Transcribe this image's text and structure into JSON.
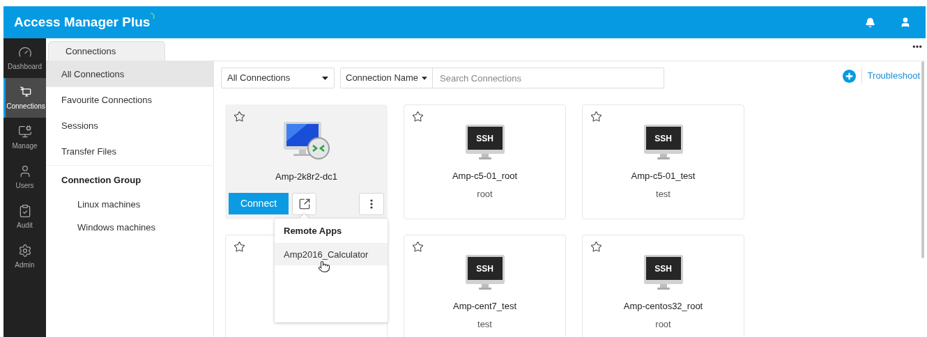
{
  "header": {
    "title": "Access Manager Plus"
  },
  "nav": [
    {
      "label": "Dashboard",
      "selected": false
    },
    {
      "label": "Connections",
      "selected": true
    },
    {
      "label": "Manage",
      "selected": false
    },
    {
      "label": "Users",
      "selected": false
    },
    {
      "label": "Audit",
      "selected": false
    },
    {
      "label": "Admin",
      "selected": false
    }
  ],
  "tab": {
    "label": "Connections"
  },
  "menu": [
    {
      "label": "All Connections",
      "selected": true
    },
    {
      "label": "Favourite Connections",
      "selected": false
    },
    {
      "label": "Sessions",
      "selected": false
    },
    {
      "label": "Transfer Files",
      "selected": false
    }
  ],
  "group": {
    "title": "Connection Group",
    "items": [
      "Linux machines",
      "Windows machines"
    ]
  },
  "toolbar": {
    "filter": "All Connections",
    "field": "Connection Name",
    "search_placeholder": "Search Connections",
    "link": "Troubleshoot"
  },
  "cards": [
    {
      "kind": "rdp",
      "name": "Amp-2k8r2-dc1",
      "selected": true,
      "action": "Connect"
    },
    {
      "kind": "ssh",
      "screen": "SSH",
      "name": "Amp-c5-01_root",
      "user": "root",
      "selected": false
    },
    {
      "kind": "ssh",
      "screen": "SSH",
      "name": "Amp-c5-01_test",
      "user": "test",
      "selected": false
    },
    {
      "kind": "covered",
      "selected": false
    },
    {
      "kind": "ssh",
      "screen": "SSH",
      "name": "Amp-cent7_test",
      "user": "test",
      "selected": false
    },
    {
      "kind": "ssh",
      "screen": "SSH",
      "name": "Amp-centos32_root",
      "user": "root",
      "selected": false
    }
  ],
  "popup": {
    "title": "Remote Apps",
    "items": [
      {
        "label": "Amp2016_Calculator",
        "selected": true
      }
    ]
  }
}
